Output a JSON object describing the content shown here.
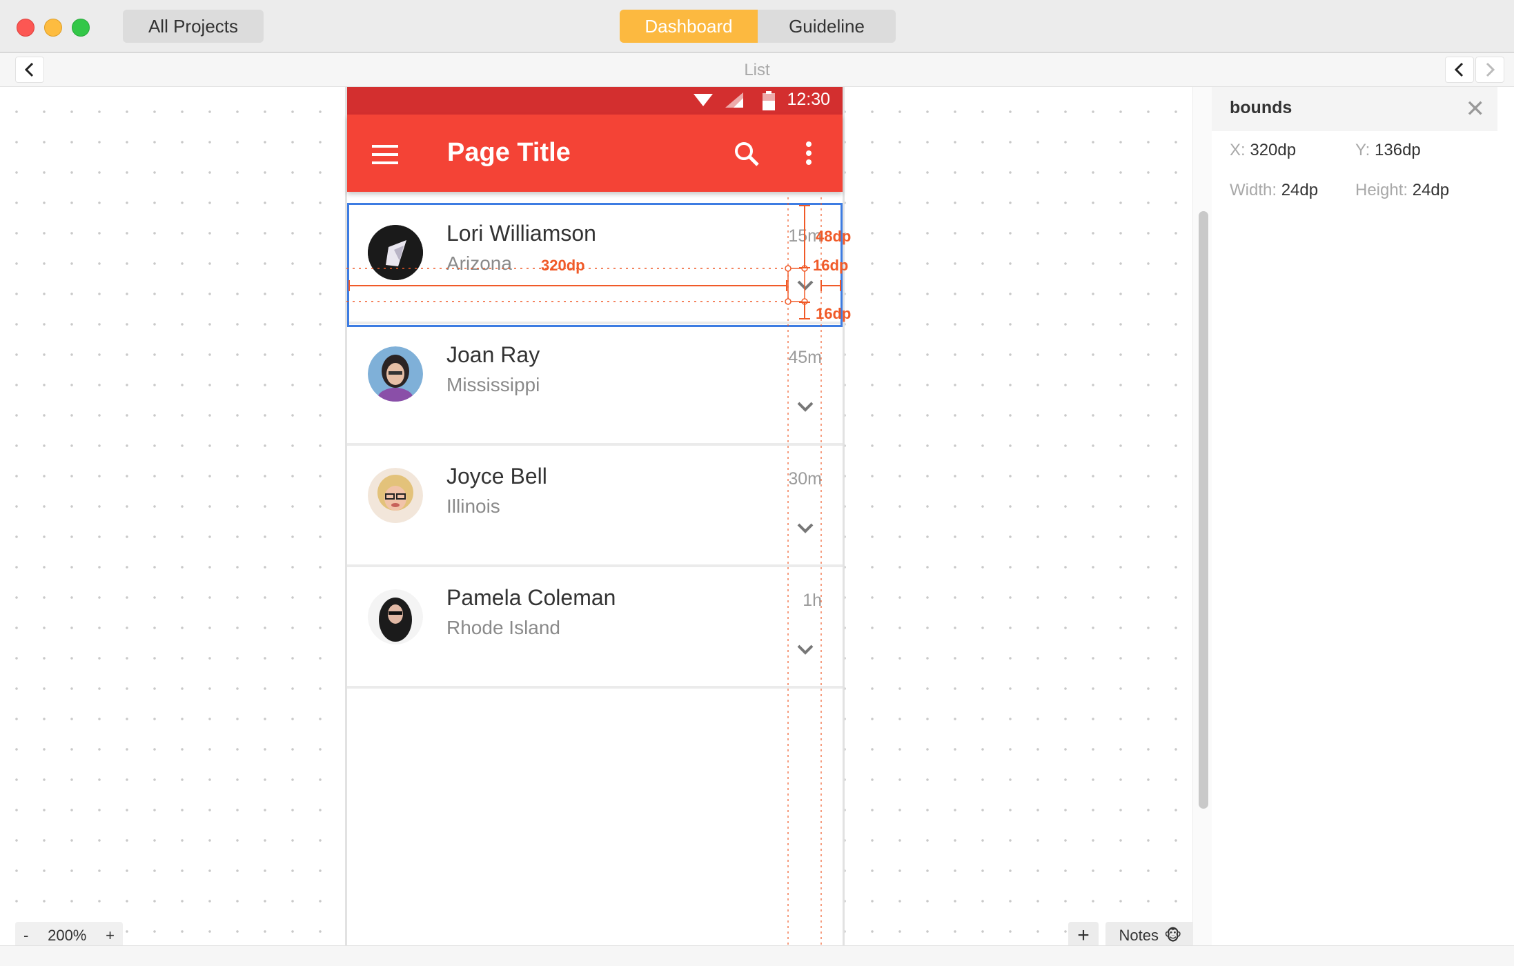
{
  "window": {
    "all_projects_label": "All Projects",
    "tabs": [
      {
        "label": "Dashboard",
        "active": true
      },
      {
        "label": "Guideline",
        "active": false
      }
    ],
    "accent_color": "#fcb940"
  },
  "nav": {
    "title": "List",
    "back_icon": "chevron-left-icon",
    "prev_icon": "chevron-left-icon",
    "next_icon": "chevron-right-icon"
  },
  "phone": {
    "status_time": "12:30",
    "app_title": "Page Title",
    "appbar_color": "#f44336",
    "statusbar_color": "#d32f2f",
    "items": [
      {
        "name": "Lori Williamson",
        "location": "Arizona",
        "time": "15m"
      },
      {
        "name": "Joan Ray",
        "location": "Mississippi",
        "time": "45m"
      },
      {
        "name": "Joyce Bell",
        "location": "Illinois",
        "time": "30m"
      },
      {
        "name": "Pamela Coleman",
        "location": "Rhode Island",
        "time": "1h"
      }
    ]
  },
  "annotations": {
    "width_label": "320dp",
    "height_label": "48dp",
    "margin_top_label": "16dp",
    "margin_bottom_label": "16dp",
    "color": "#f05a28"
  },
  "zoom": {
    "minus": "-",
    "value": "200%",
    "plus": "+"
  },
  "toolbar": {
    "add_label": "+",
    "notes_label": "Notes",
    "notes_emoji": "🐵"
  },
  "inspector": {
    "title": "bounds",
    "x_key": "X:",
    "x_value": "320dp",
    "y_key": "Y:",
    "y_value": "136dp",
    "width_key": "Width:",
    "width_value": "24dp",
    "height_key": "Height:",
    "height_value": "24dp"
  }
}
